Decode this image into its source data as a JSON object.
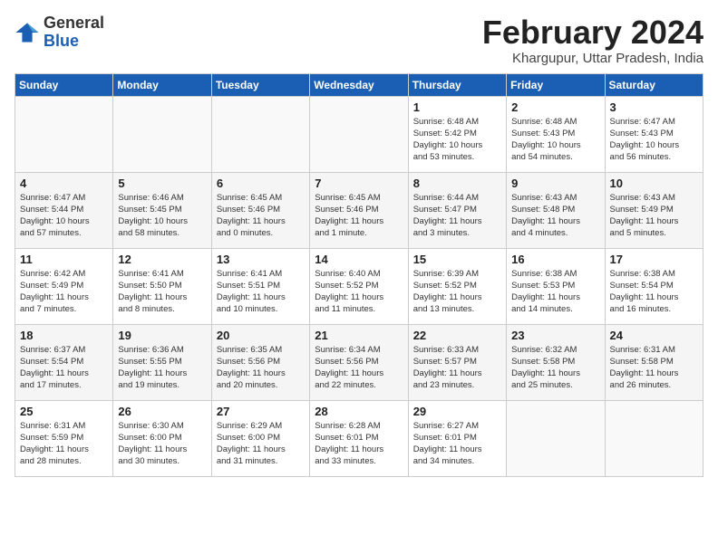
{
  "logo": {
    "general": "General",
    "blue": "Blue"
  },
  "title": {
    "month_year": "February 2024",
    "location": "Khargupur, Uttar Pradesh, India"
  },
  "headers": [
    "Sunday",
    "Monday",
    "Tuesday",
    "Wednesday",
    "Thursday",
    "Friday",
    "Saturday"
  ],
  "weeks": [
    [
      {
        "day": "",
        "info": ""
      },
      {
        "day": "",
        "info": ""
      },
      {
        "day": "",
        "info": ""
      },
      {
        "day": "",
        "info": ""
      },
      {
        "day": "1",
        "info": "Sunrise: 6:48 AM\nSunset: 5:42 PM\nDaylight: 10 hours\nand 53 minutes."
      },
      {
        "day": "2",
        "info": "Sunrise: 6:48 AM\nSunset: 5:43 PM\nDaylight: 10 hours\nand 54 minutes."
      },
      {
        "day": "3",
        "info": "Sunrise: 6:47 AM\nSunset: 5:43 PM\nDaylight: 10 hours\nand 56 minutes."
      }
    ],
    [
      {
        "day": "4",
        "info": "Sunrise: 6:47 AM\nSunset: 5:44 PM\nDaylight: 10 hours\nand 57 minutes."
      },
      {
        "day": "5",
        "info": "Sunrise: 6:46 AM\nSunset: 5:45 PM\nDaylight: 10 hours\nand 58 minutes."
      },
      {
        "day": "6",
        "info": "Sunrise: 6:45 AM\nSunset: 5:46 PM\nDaylight: 11 hours\nand 0 minutes."
      },
      {
        "day": "7",
        "info": "Sunrise: 6:45 AM\nSunset: 5:46 PM\nDaylight: 11 hours\nand 1 minute."
      },
      {
        "day": "8",
        "info": "Sunrise: 6:44 AM\nSunset: 5:47 PM\nDaylight: 11 hours\nand 3 minutes."
      },
      {
        "day": "9",
        "info": "Sunrise: 6:43 AM\nSunset: 5:48 PM\nDaylight: 11 hours\nand 4 minutes."
      },
      {
        "day": "10",
        "info": "Sunrise: 6:43 AM\nSunset: 5:49 PM\nDaylight: 11 hours\nand 5 minutes."
      }
    ],
    [
      {
        "day": "11",
        "info": "Sunrise: 6:42 AM\nSunset: 5:49 PM\nDaylight: 11 hours\nand 7 minutes."
      },
      {
        "day": "12",
        "info": "Sunrise: 6:41 AM\nSunset: 5:50 PM\nDaylight: 11 hours\nand 8 minutes."
      },
      {
        "day": "13",
        "info": "Sunrise: 6:41 AM\nSunset: 5:51 PM\nDaylight: 11 hours\nand 10 minutes."
      },
      {
        "day": "14",
        "info": "Sunrise: 6:40 AM\nSunset: 5:52 PM\nDaylight: 11 hours\nand 11 minutes."
      },
      {
        "day": "15",
        "info": "Sunrise: 6:39 AM\nSunset: 5:52 PM\nDaylight: 11 hours\nand 13 minutes."
      },
      {
        "day": "16",
        "info": "Sunrise: 6:38 AM\nSunset: 5:53 PM\nDaylight: 11 hours\nand 14 minutes."
      },
      {
        "day": "17",
        "info": "Sunrise: 6:38 AM\nSunset: 5:54 PM\nDaylight: 11 hours\nand 16 minutes."
      }
    ],
    [
      {
        "day": "18",
        "info": "Sunrise: 6:37 AM\nSunset: 5:54 PM\nDaylight: 11 hours\nand 17 minutes."
      },
      {
        "day": "19",
        "info": "Sunrise: 6:36 AM\nSunset: 5:55 PM\nDaylight: 11 hours\nand 19 minutes."
      },
      {
        "day": "20",
        "info": "Sunrise: 6:35 AM\nSunset: 5:56 PM\nDaylight: 11 hours\nand 20 minutes."
      },
      {
        "day": "21",
        "info": "Sunrise: 6:34 AM\nSunset: 5:56 PM\nDaylight: 11 hours\nand 22 minutes."
      },
      {
        "day": "22",
        "info": "Sunrise: 6:33 AM\nSunset: 5:57 PM\nDaylight: 11 hours\nand 23 minutes."
      },
      {
        "day": "23",
        "info": "Sunrise: 6:32 AM\nSunset: 5:58 PM\nDaylight: 11 hours\nand 25 minutes."
      },
      {
        "day": "24",
        "info": "Sunrise: 6:31 AM\nSunset: 5:58 PM\nDaylight: 11 hours\nand 26 minutes."
      }
    ],
    [
      {
        "day": "25",
        "info": "Sunrise: 6:31 AM\nSunset: 5:59 PM\nDaylight: 11 hours\nand 28 minutes."
      },
      {
        "day": "26",
        "info": "Sunrise: 6:30 AM\nSunset: 6:00 PM\nDaylight: 11 hours\nand 30 minutes."
      },
      {
        "day": "27",
        "info": "Sunrise: 6:29 AM\nSunset: 6:00 PM\nDaylight: 11 hours\nand 31 minutes."
      },
      {
        "day": "28",
        "info": "Sunrise: 6:28 AM\nSunset: 6:01 PM\nDaylight: 11 hours\nand 33 minutes."
      },
      {
        "day": "29",
        "info": "Sunrise: 6:27 AM\nSunset: 6:01 PM\nDaylight: 11 hours\nand 34 minutes."
      },
      {
        "day": "",
        "info": ""
      },
      {
        "day": "",
        "info": ""
      }
    ]
  ]
}
